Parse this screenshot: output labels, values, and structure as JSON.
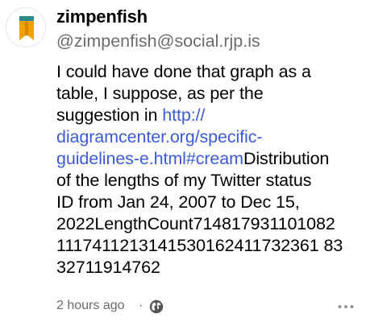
{
  "post": {
    "display_name": "zimpenfish",
    "handle": "@zimpenfish@social.rjp.is",
    "body_lines": [
      {
        "text": "I could have done that graph as a",
        "link": "",
        "rest": ""
      },
      {
        "text": "table, I suppose, as per the",
        "link": "",
        "rest": ""
      },
      {
        "text": "suggestion in ",
        "link": "http://",
        "rest": ""
      },
      {
        "text": "",
        "link": "diagramcenter.org/specific-",
        "rest": ""
      },
      {
        "text": "",
        "link": "guidelines-e.html#cream",
        "rest": "Distribution"
      },
      {
        "text": "of the lengths of my Twitter status",
        "link": "",
        "rest": ""
      },
      {
        "text": "ID from Jan 24, 2007 to Dec 15,",
        "link": "",
        "rest": ""
      },
      {
        "text": "2022LengthCount714817931101082",
        "link": "",
        "rest": ""
      },
      {
        "text": "1117411213141530162411732361 83",
        "link": "",
        "rest": ""
      },
      {
        "text": "32711914762",
        "link": "",
        "rest": ""
      }
    ],
    "time_ago": "2 hours ago",
    "separator": "·"
  },
  "icons": {
    "avatar": "zimpenfish-bookmark-avatar",
    "visibility": "globe-icon",
    "more": "more-options-icon"
  },
  "colors": {
    "link": "#3b5bd9",
    "muted": "#6b6b6b",
    "avatar_teal": "#2e8b8b",
    "avatar_orange": "#f0a202"
  }
}
